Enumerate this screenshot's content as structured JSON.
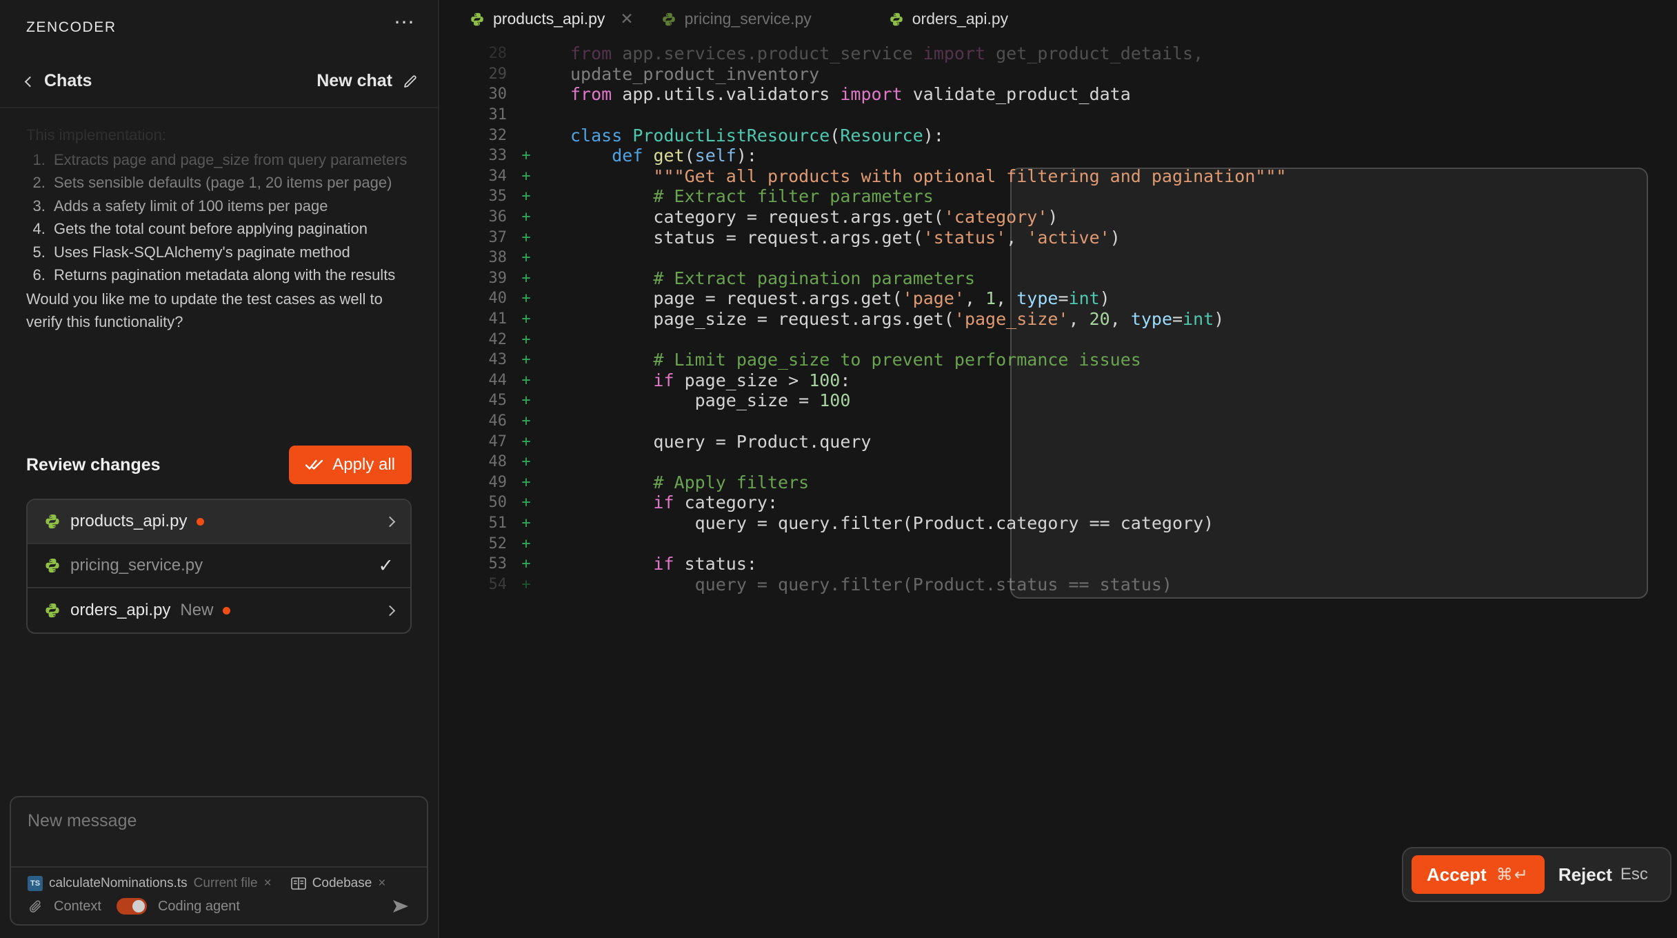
{
  "sidebar": {
    "brand": "ZENCODER",
    "menu_icon": "ellipsis-icon",
    "back_label": "Chats",
    "new_chat_label": "New chat",
    "conversation": {
      "intro": "This implementation:",
      "items": [
        "Extracts page and page_size from query parameters",
        "Sets sensible defaults (page 1, 20 items per page)",
        "Adds a safety limit of 100 items per page",
        "Gets the total count before applying pagination",
        "Uses Flask-SQLAlchemy's paginate method",
        "Returns pagination metadata along with the results"
      ],
      "outro": "Would you like me to update the test cases as well to verify this functionality?"
    },
    "review": {
      "title": "Review changes",
      "apply_all_label": "Apply all",
      "files": [
        {
          "name": "products_api.py",
          "tag": "",
          "has_dot": true,
          "state": "active",
          "action": "chevron"
        },
        {
          "name": "pricing_service.py",
          "tag": "",
          "has_dot": false,
          "state": "applied",
          "action": "check"
        },
        {
          "name": "orders_api.py",
          "tag": "New",
          "has_dot": true,
          "state": "default",
          "action": "chevron"
        }
      ]
    },
    "composer": {
      "placeholder": "New message",
      "value": "",
      "chips": [
        {
          "icon": "ts-file-icon",
          "label": "calculateNominations.ts",
          "sub": "Current file",
          "close": "×"
        },
        {
          "icon": "codebase-icon",
          "label": "Codebase",
          "sub": "",
          "close": "×"
        }
      ],
      "context_label": "Context",
      "agent_label": "Coding agent",
      "agent_enabled": true,
      "send_icon": "send-arrow-icon",
      "attach_icon": "paperclip-icon"
    }
  },
  "editor": {
    "tabs": [
      {
        "label": "products_api.py",
        "active": true,
        "closable": true,
        "icon": "python-icon"
      },
      {
        "label": "pricing_service.py",
        "active": false,
        "closable": false,
        "icon": "python-icon"
      },
      {
        "label": "orders_api.py",
        "active": false,
        "closable": false,
        "icon": "python-icon"
      }
    ],
    "diff_actions": {
      "accept_label": "Accept",
      "accept_keys": "⌘↵",
      "reject_label": "Reject",
      "reject_key": "Esc"
    },
    "code": {
      "first_line": 28,
      "lines": [
        {
          "n": 28,
          "sign": "",
          "state": "faded-28",
          "tokens": [
            {
              "t": "from ",
              "c": "t-kw"
            },
            {
              "t": "app.services.product_service ",
              "c": "t-plain"
            },
            {
              "t": "import ",
              "c": "t-kw"
            },
            {
              "t": "get_product_details,",
              "c": "t-plain"
            }
          ]
        },
        {
          "n": 29,
          "sign": "",
          "state": "faded-29",
          "tokens": [
            {
              "t": "update_product_inventory",
              "c": "t-plain"
            }
          ]
        },
        {
          "n": 30,
          "sign": "",
          "state": "",
          "tokens": [
            {
              "t": "from ",
              "c": "t-kw"
            },
            {
              "t": "app.utils.validators ",
              "c": "t-plain"
            },
            {
              "t": "import ",
              "c": "t-kw"
            },
            {
              "t": "validate_product_data",
              "c": "t-plain"
            }
          ]
        },
        {
          "n": 31,
          "sign": "",
          "state": "",
          "tokens": []
        },
        {
          "n": 32,
          "sign": "",
          "state": "",
          "tokens": [
            {
              "t": "class ",
              "c": "t-kw2"
            },
            {
              "t": "ProductListResource",
              "c": "t-cls"
            },
            {
              "t": "(",
              "c": "t-punct"
            },
            {
              "t": "Resource",
              "c": "t-cls"
            },
            {
              "t": "):",
              "c": "t-punct"
            }
          ]
        },
        {
          "n": 33,
          "sign": "+",
          "state": "",
          "tokens": [
            {
              "t": "    ",
              "c": "t-plain"
            },
            {
              "t": "def ",
              "c": "t-kw2"
            },
            {
              "t": "get",
              "c": "t-fn"
            },
            {
              "t": "(",
              "c": "t-punct"
            },
            {
              "t": "self",
              "c": "t-self"
            },
            {
              "t": "):",
              "c": "t-punct"
            }
          ]
        },
        {
          "n": 34,
          "sign": "+",
          "state": "",
          "tokens": [
            {
              "t": "        ",
              "c": "t-plain"
            },
            {
              "t": "\"\"\"Get all products with optional filtering and pagination\"\"\"",
              "c": "t-doc"
            }
          ]
        },
        {
          "n": 35,
          "sign": "+",
          "state": "",
          "tokens": [
            {
              "t": "        ",
              "c": "t-plain"
            },
            {
              "t": "# Extract filter parameters",
              "c": "t-com"
            }
          ]
        },
        {
          "n": 36,
          "sign": "+",
          "state": "",
          "tokens": [
            {
              "t": "        category = request.args.get(",
              "c": "t-plain"
            },
            {
              "t": "'category'",
              "c": "t-str"
            },
            {
              "t": ")",
              "c": "t-punct"
            }
          ]
        },
        {
          "n": 37,
          "sign": "+",
          "state": "",
          "tokens": [
            {
              "t": "        status = request.args.get(",
              "c": "t-plain"
            },
            {
              "t": "'status'",
              "c": "t-str"
            },
            {
              "t": ", ",
              "c": "t-punct"
            },
            {
              "t": "'active'",
              "c": "t-str"
            },
            {
              "t": ")",
              "c": "t-punct"
            }
          ]
        },
        {
          "n": 38,
          "sign": "+",
          "state": "",
          "tokens": []
        },
        {
          "n": 39,
          "sign": "+",
          "state": "",
          "tokens": [
            {
              "t": "        ",
              "c": "t-plain"
            },
            {
              "t": "# Extract pagination parameters",
              "c": "t-com"
            }
          ]
        },
        {
          "n": 40,
          "sign": "+",
          "state": "",
          "tokens": [
            {
              "t": "        page = request.args.get(",
              "c": "t-plain"
            },
            {
              "t": "'page'",
              "c": "t-str"
            },
            {
              "t": ", ",
              "c": "t-punct"
            },
            {
              "t": "1",
              "c": "t-num"
            },
            {
              "t": ", ",
              "c": "t-punct"
            },
            {
              "t": "type",
              "c": "t-param"
            },
            {
              "t": "=",
              "c": "t-punct"
            },
            {
              "t": "int",
              "c": "t-type"
            },
            {
              "t": ")",
              "c": "t-punct"
            }
          ]
        },
        {
          "n": 41,
          "sign": "+",
          "state": "",
          "tokens": [
            {
              "t": "        page_size = request.args.get(",
              "c": "t-plain"
            },
            {
              "t": "'page_size'",
              "c": "t-str"
            },
            {
              "t": ", ",
              "c": "t-punct"
            },
            {
              "t": "20",
              "c": "t-num"
            },
            {
              "t": ", ",
              "c": "t-punct"
            },
            {
              "t": "type",
              "c": "t-param"
            },
            {
              "t": "=",
              "c": "t-punct"
            },
            {
              "t": "int",
              "c": "t-type"
            },
            {
              "t": ")",
              "c": "t-punct"
            }
          ]
        },
        {
          "n": 42,
          "sign": "+",
          "state": "",
          "tokens": []
        },
        {
          "n": 43,
          "sign": "+",
          "state": "",
          "tokens": [
            {
              "t": "        ",
              "c": "t-plain"
            },
            {
              "t": "# Limit page_size to prevent performance issues",
              "c": "t-com"
            }
          ]
        },
        {
          "n": 44,
          "sign": "+",
          "state": "",
          "tokens": [
            {
              "t": "        ",
              "c": "t-plain"
            },
            {
              "t": "if ",
              "c": "t-kw"
            },
            {
              "t": "page_size > ",
              "c": "t-plain"
            },
            {
              "t": "100",
              "c": "t-num"
            },
            {
              "t": ":",
              "c": "t-punct"
            }
          ]
        },
        {
          "n": 45,
          "sign": "+",
          "state": "",
          "tokens": [
            {
              "t": "            page_size = ",
              "c": "t-plain"
            },
            {
              "t": "100",
              "c": "t-num"
            }
          ]
        },
        {
          "n": 46,
          "sign": "+",
          "state": "",
          "tokens": []
        },
        {
          "n": 47,
          "sign": "+",
          "state": "",
          "tokens": [
            {
              "t": "        query = Product.query",
              "c": "t-plain"
            }
          ]
        },
        {
          "n": 48,
          "sign": "+",
          "state": "",
          "tokens": []
        },
        {
          "n": 49,
          "sign": "+",
          "state": "",
          "tokens": [
            {
              "t": "        ",
              "c": "t-plain"
            },
            {
              "t": "# Apply filters",
              "c": "t-com"
            }
          ]
        },
        {
          "n": 50,
          "sign": "+",
          "state": "",
          "tokens": [
            {
              "t": "        ",
              "c": "t-plain"
            },
            {
              "t": "if ",
              "c": "t-kw"
            },
            {
              "t": "category:",
              "c": "t-plain"
            }
          ]
        },
        {
          "n": 51,
          "sign": "+",
          "state": "",
          "tokens": [
            {
              "t": "            query = query.filter(Product.category == category)",
              "c": "t-plain"
            }
          ]
        },
        {
          "n": 52,
          "sign": "+",
          "state": "",
          "tokens": []
        },
        {
          "n": 53,
          "sign": "+",
          "state": "",
          "tokens": [
            {
              "t": "        ",
              "c": "t-plain"
            },
            {
              "t": "if ",
              "c": "t-kw"
            },
            {
              "t": "status:",
              "c": "t-plain"
            }
          ]
        },
        {
          "n": 54,
          "sign": "+",
          "state": "faded-54",
          "tokens": [
            {
              "t": "            query = query.filter(Product.status == status)",
              "c": "t-plain"
            }
          ]
        }
      ]
    }
  },
  "colors": {
    "accent": "#f04e14",
    "python_icon": "#8fbf47",
    "diff_add": "#2fa85a",
    "sidebar_bg": "#1b1b1b",
    "editor_bg": "#161616"
  }
}
